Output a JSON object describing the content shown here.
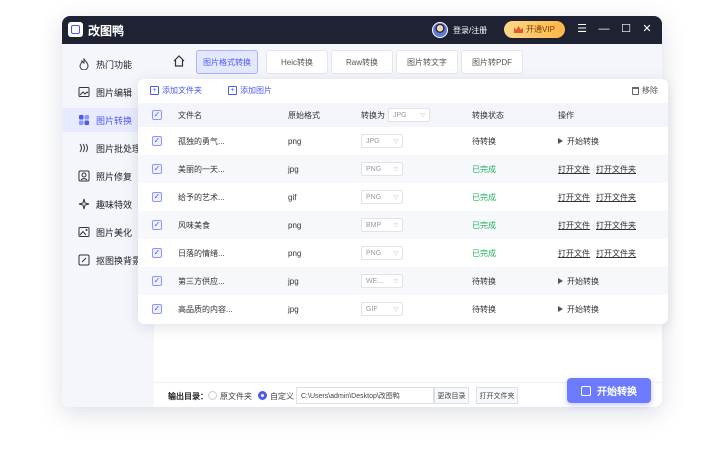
{
  "app": {
    "title": "改图鸭",
    "login_text": "登录/注册",
    "vip_label": "开通VIP"
  },
  "window_controls": [
    "☰",
    "—",
    "☐",
    "✕"
  ],
  "sidebar": {
    "items": [
      {
        "label": "热门功能",
        "icon": "flame-icon"
      },
      {
        "label": "图片编辑",
        "icon": "image-edit-icon"
      },
      {
        "label": "图片转换",
        "icon": "convert-icon",
        "active": true
      },
      {
        "label": "图片批处理",
        "icon": "batch-icon"
      },
      {
        "label": "照片修复",
        "icon": "photo-repair-icon"
      },
      {
        "label": "趣味特效",
        "icon": "sparkle-icon"
      },
      {
        "label": "图片美化",
        "icon": "beautify-icon"
      },
      {
        "label": "抠图换背景",
        "icon": "cutout-icon"
      }
    ]
  },
  "tabs": [
    {
      "label": "图片格式转换",
      "active": true
    },
    {
      "label": "Heic转换"
    },
    {
      "label": "Raw转换"
    },
    {
      "label": "图片转文字"
    },
    {
      "label": "图片转PDF"
    }
  ],
  "toolbar": {
    "add_folder": "添加文件夹",
    "add_image": "添加图片",
    "remove": "移除"
  },
  "table": {
    "headers": {
      "name": "文件名",
      "original_format": "原始格式",
      "convert_to": "转换为",
      "convert_to_value": "JPG",
      "status": "转换状态",
      "action": "操作"
    },
    "rows": [
      {
        "name": "孤独的勇气...",
        "format": "png",
        "target": "JPG",
        "status": "待转换",
        "done": false,
        "action": "开始转换"
      },
      {
        "name": "美丽的一天...",
        "format": "jpg",
        "target": "PNG",
        "status": "已完成",
        "done": true,
        "open_file": "打开文件",
        "open_folder": "打开文件夹"
      },
      {
        "name": "给予的艺术...",
        "format": "gif",
        "target": "PNG",
        "status": "已完成",
        "done": true,
        "open_file": "打开文件",
        "open_folder": "打开文件夹"
      },
      {
        "name": "风味美食",
        "format": "png",
        "target": "BMP",
        "status": "已完成",
        "done": true,
        "open_file": "打开文件",
        "open_folder": "打开文件夹"
      },
      {
        "name": "日落的情绪...",
        "format": "png",
        "target": "PNG",
        "status": "已完成",
        "done": true,
        "open_file": "打开文件",
        "open_folder": "打开文件夹"
      },
      {
        "name": "第三方供应...",
        "format": "jpg",
        "target": "WE...",
        "status": "待转换",
        "done": false,
        "action": "开始转换"
      },
      {
        "name": "高品质的内容...",
        "format": "jpg",
        "target": "GIF",
        "status": "待转换",
        "done": false,
        "action": "开始转换"
      }
    ]
  },
  "footer": {
    "output_label": "输出目录：",
    "option_original": "原文件夹",
    "option_custom": "自定义",
    "path": "C:\\Users\\admin\\Desktop\\改图鸭",
    "change_dir": "更改目录",
    "open_folder": "打开文件夹",
    "start": "开始转换"
  },
  "colors": {
    "accent": "#4a5bf0",
    "success": "#22b35e",
    "titlebar": "#1f2233",
    "vip": "#ffb648"
  }
}
